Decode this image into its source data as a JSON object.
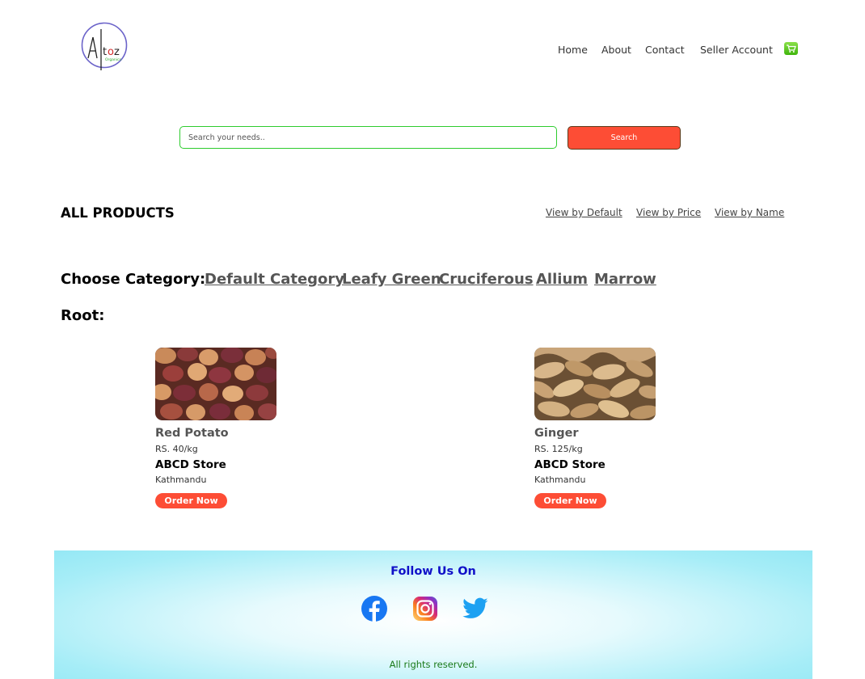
{
  "header": {
    "logo_text": "Atoz Organics",
    "nav": [
      "Home",
      "About",
      "Contact",
      "Seller Account"
    ],
    "cart_icon": "shopping-cart-icon"
  },
  "search": {
    "placeholder": "Search your needs..",
    "value": "",
    "button_label": "Search"
  },
  "products_section": {
    "title": "ALL PRODUCTS",
    "sort_options": [
      "View by Default",
      "View by Price",
      "View by Name"
    ]
  },
  "categories": {
    "label": "Choose Category:",
    "items": [
      "Default Category",
      "Leafy Green",
      "Cruciferous",
      "Allium",
      "Marrow"
    ],
    "current": "Root:"
  },
  "products": [
    {
      "name": "Red Potato",
      "price": "RS. 40/kg",
      "store": "ABCD Store",
      "location": "Kathmandu",
      "button": "Order Now"
    },
    {
      "name": "Ginger",
      "price": "RS. 125/kg",
      "store": "ABCD Store",
      "location": "Kathmandu",
      "button": "Order Now"
    }
  ],
  "footer": {
    "follow_title": "Follow Us On",
    "social_icons": [
      "facebook-icon",
      "instagram-icon",
      "twitter-icon"
    ],
    "copyright": "All rights reserved."
  },
  "colors": {
    "accent": "#fd4d35",
    "search_border": "#2ecc2e",
    "follow_title": "#1010c8",
    "footer_text": "#1a7a1a"
  }
}
